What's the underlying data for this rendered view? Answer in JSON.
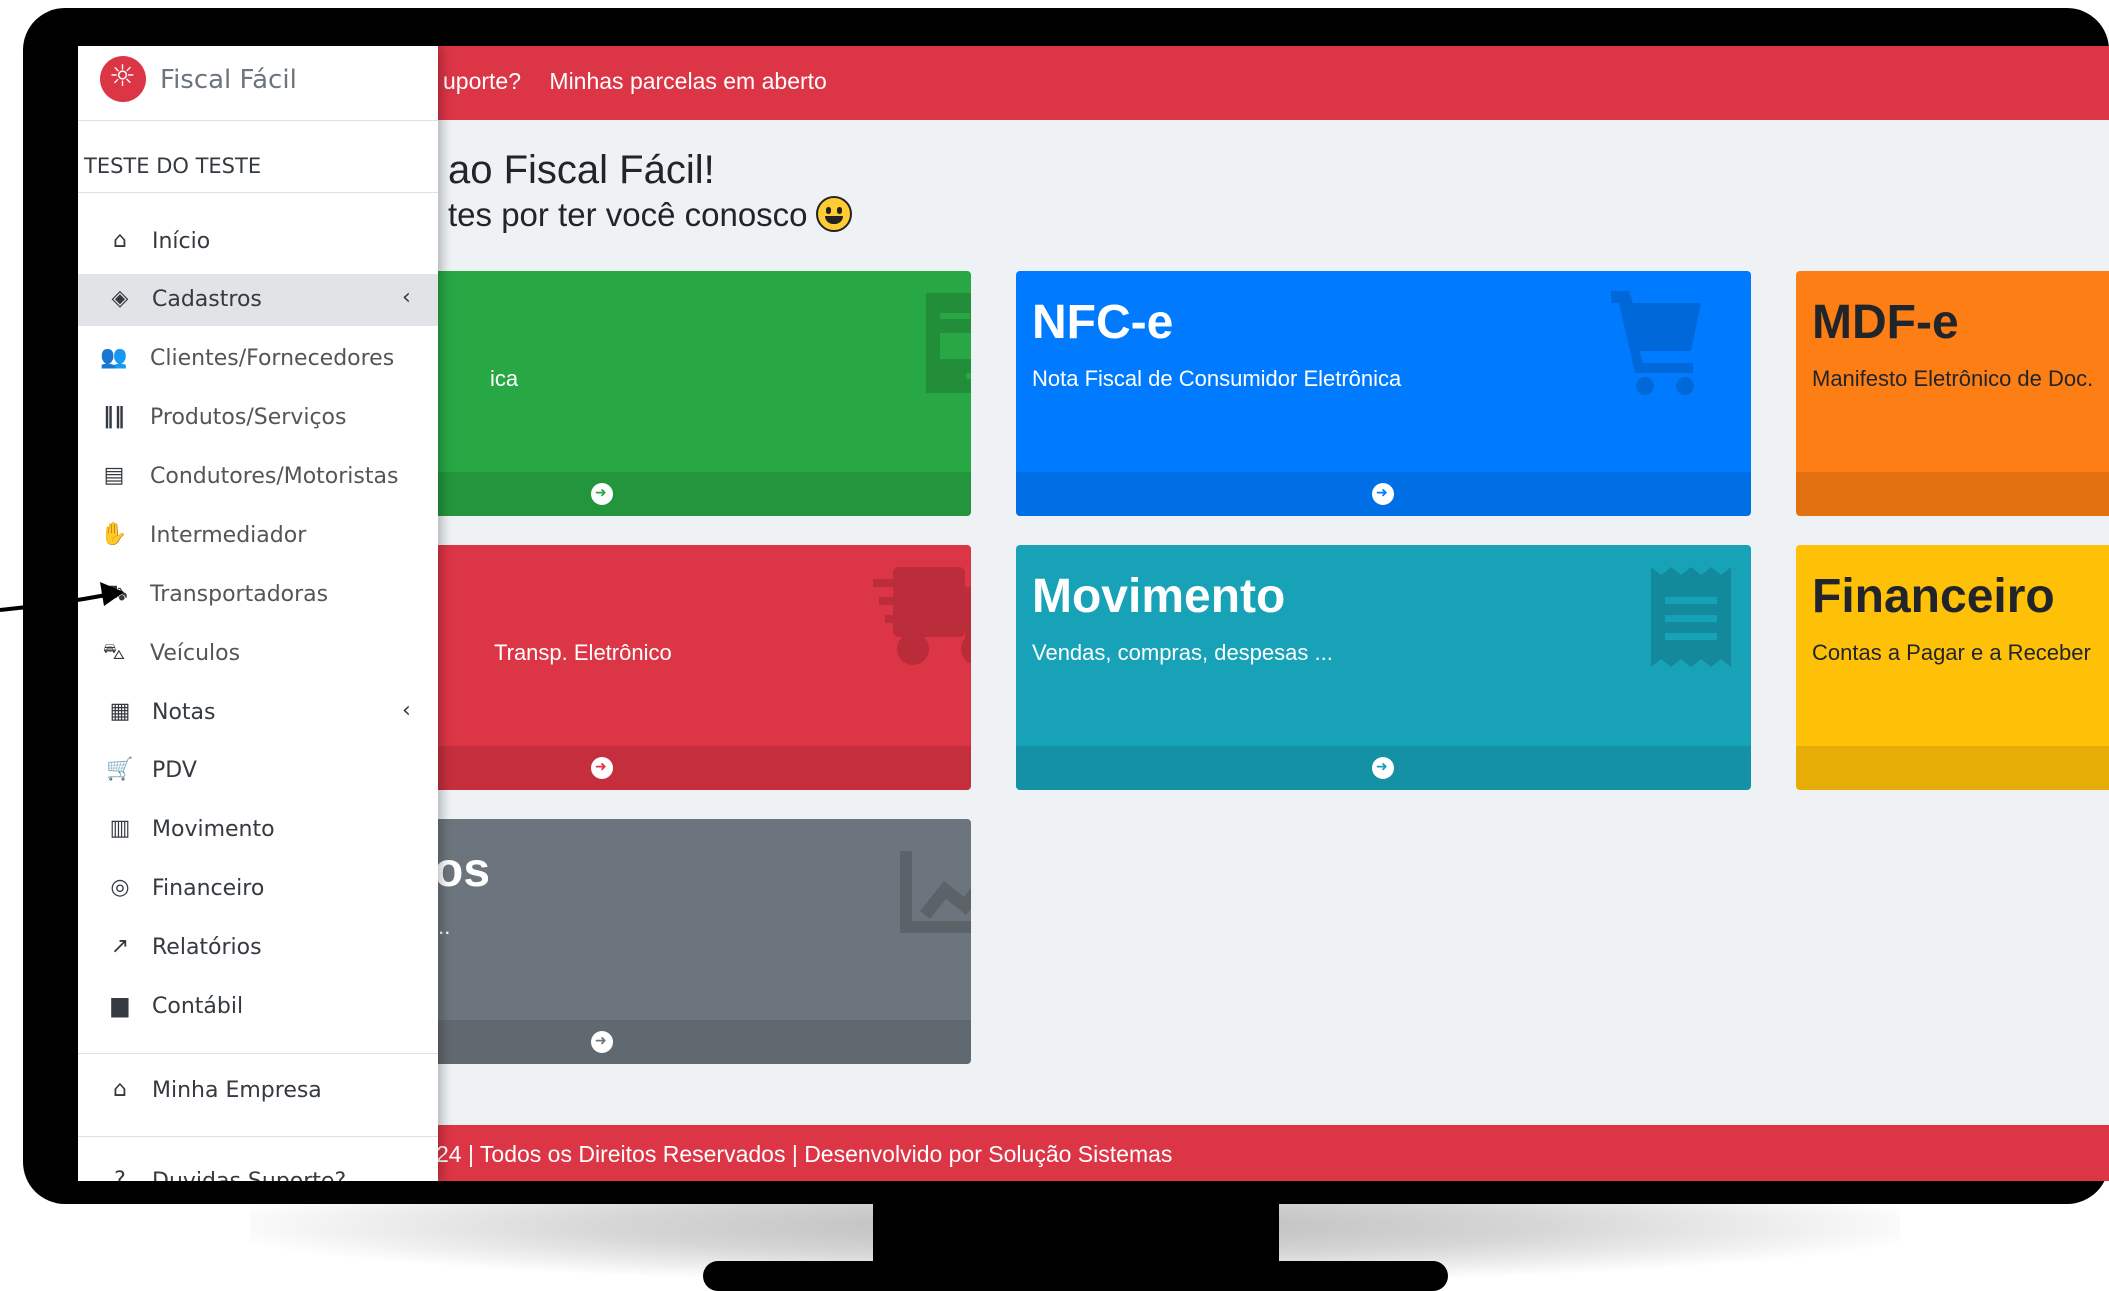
{
  "topbar": {
    "link_support": "uporte?",
    "link_parcelas": "Minhas parcelas em aberto"
  },
  "welcome": {
    "line1": "ao Fiscal Fácil!",
    "line2": "tes por ter você conosco"
  },
  "sidebar": {
    "brand": "Fiscal Fácil",
    "company": "TESTE DO TESTE",
    "items": [
      {
        "label": "Início",
        "icon": "home-icon"
      },
      {
        "label": "Cadastros",
        "icon": "box-icon"
      },
      {
        "label": "Clientes/Fornecedores",
        "icon": "users-icon"
      },
      {
        "label": "Produtos/Serviços",
        "icon": "barcode-icon"
      },
      {
        "label": "Condutores/Motoristas",
        "icon": "id-card-icon"
      },
      {
        "label": "Intermediador",
        "icon": "handshake-icon"
      },
      {
        "label": "Transportadoras",
        "icon": "truck-icon"
      },
      {
        "label": "Veículos",
        "icon": "car-icon"
      },
      {
        "label": "Notas",
        "icon": "file-icon"
      },
      {
        "label": "PDV",
        "icon": "cart-icon"
      },
      {
        "label": "Movimento",
        "icon": "receipt-icon"
      },
      {
        "label": "Financeiro",
        "icon": "coins-icon"
      },
      {
        "label": "Relatórios",
        "icon": "chart-line-icon"
      },
      {
        "label": "Contábil",
        "icon": "book-icon"
      },
      {
        "label": "Minha Empresa",
        "icon": "store-icon"
      },
      {
        "label": "Duvidas Suporte?",
        "icon": "question-icon"
      }
    ]
  },
  "cards": {
    "nfe": {
      "desc": "ica",
      "color": "#28a745"
    },
    "nfce": {
      "title": "NFC-e",
      "desc": "Nota Fiscal de Consumidor Eletrônica",
      "color": "#007bff"
    },
    "mdfe": {
      "title": "MDF-e",
      "desc": "Manifesto Eletrônico de Doc.",
      "color": "#fd7e14"
    },
    "cte": {
      "desc": "Transp. Eletrônico",
      "color": "#dc3545"
    },
    "movimento": {
      "title": "Movimento",
      "desc": "Vendas, compras, despesas ...",
      "color": "#17a2b8"
    },
    "financeiro": {
      "title": "Financeiro",
      "desc": "Contas a Pagar e a Receber",
      "color": "#ffc107"
    },
    "relatorios": {
      "title": "os",
      "desc": "...",
      "color": "#6c757d"
    }
  },
  "footer": {
    "text": "24 | Todos os Direitos Reservados | Desenvolvido por Solução Sistemas"
  }
}
